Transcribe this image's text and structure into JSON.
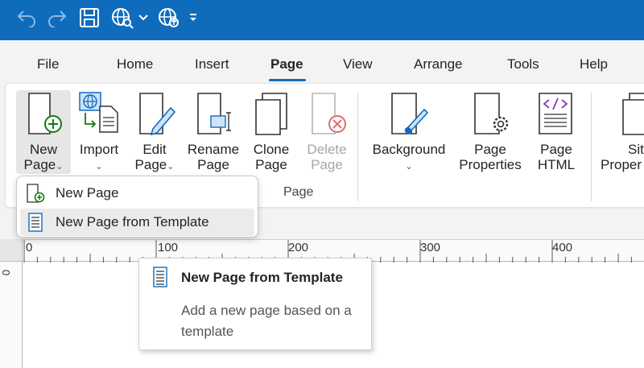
{
  "colors": {
    "accent": "#0f6cbd",
    "add_green": "#107c10",
    "disabled_red": "#e06c6c"
  },
  "quick_access": {
    "icons": [
      "undo-icon",
      "redo-icon",
      "save-icon",
      "preview-web-icon",
      "dropdown-chevron-icon",
      "publish-web-icon",
      "customize-toolbar-icon"
    ]
  },
  "tabs": [
    {
      "label": "File"
    },
    {
      "label": "Home"
    },
    {
      "label": "Insert"
    },
    {
      "label": "Page",
      "active": true
    },
    {
      "label": "View"
    },
    {
      "label": "Arrange"
    },
    {
      "label": "Tools"
    },
    {
      "label": "Help"
    }
  ],
  "ribbon": {
    "new_page": {
      "line1": "New",
      "line2": "Page",
      "chevron": "⌄"
    },
    "import": {
      "line1": "Import",
      "chevron": "⌄"
    },
    "edit_page": {
      "line1": "Edit",
      "line2": "Page",
      "chevron": "⌄"
    },
    "rename_page": {
      "line1": "Rename",
      "line2": "Page"
    },
    "clone_page": {
      "line1": "Clone",
      "line2": "Page"
    },
    "delete_page": {
      "line1": "Delete",
      "line2": "Page"
    },
    "background": {
      "line1": "Background",
      "chevron": "⌄"
    },
    "page_properties": {
      "line1": "Page",
      "line2": "Properties"
    },
    "page_html": {
      "line1": "Page",
      "line2": "HTML"
    },
    "site_properties": {
      "line1": "Sit",
      "line2": "Proper"
    },
    "group_label": "Page"
  },
  "dropdown": {
    "items": [
      {
        "label": "New Page"
      },
      {
        "label": "New Page from Template"
      }
    ]
  },
  "ruler": {
    "labels": [
      "0",
      "100",
      "200",
      "300",
      "400"
    ],
    "vertical_label": "0"
  },
  "tooltip": {
    "title": "New Page from Template",
    "description": "Add a new page based on a template"
  }
}
